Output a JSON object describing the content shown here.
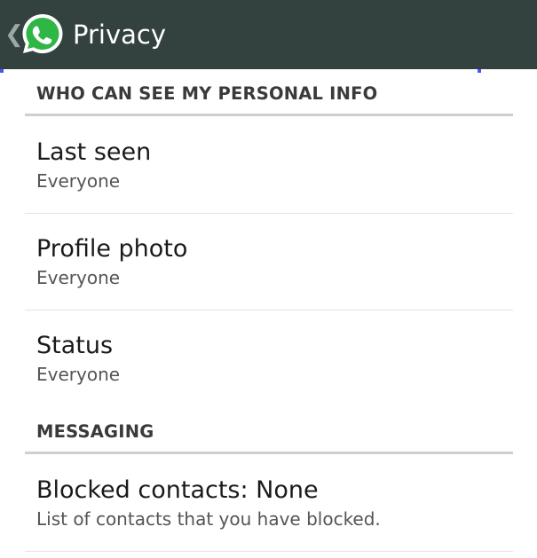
{
  "action_bar": {
    "title": "Privacy",
    "background": "#34423f",
    "back_icon": "chevron-left-icon",
    "logo_icon": "whatsapp-logo-icon",
    "logo_color": "#2fb645"
  },
  "sections": [
    {
      "header": "WHO CAN SEE MY PERSONAL INFO",
      "items": [
        {
          "title": "Last seen",
          "summary": "Everyone"
        },
        {
          "title": "Profile photo",
          "summary": "Everyone"
        },
        {
          "title": "Status",
          "summary": "Everyone"
        }
      ]
    },
    {
      "header": "MESSAGING",
      "items": [
        {
          "title": "Blocked contacts: None",
          "summary": "List of contacts that you have blocked."
        }
      ]
    }
  ],
  "colors": {
    "divider": "#cfcfcf",
    "row_divider": "#e3e3e3",
    "title_text": "#1a1a1a",
    "summary_text": "#555555"
  }
}
